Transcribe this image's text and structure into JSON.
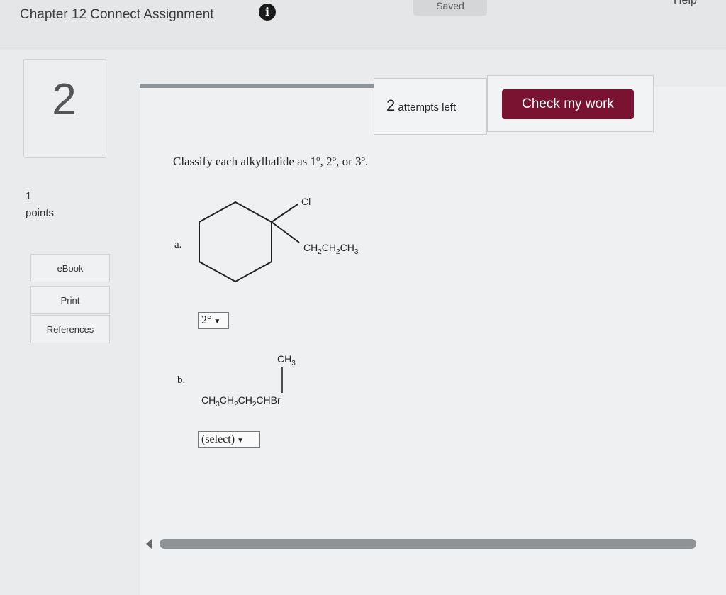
{
  "header": {
    "title": "Chapter 12 Connect Assignment",
    "info_icon": "info-icon",
    "saved": "Saved",
    "help": "Help"
  },
  "question": {
    "number": "2",
    "points_value": "1",
    "points_label": "points",
    "tools": [
      "eBook",
      "Print",
      "References"
    ],
    "attempts_count": "2",
    "attempts_text": "attempts left",
    "check_button": "Check my work",
    "prompt": "Classify each alkylhalide as 1",
    "prompt_parts": [
      "Classify each alkylhalide as 1",
      "o",
      ", 2",
      "o",
      ", or 3",
      "o",
      "."
    ]
  },
  "items": [
    {
      "label": "a.",
      "substituent_top": "Cl",
      "substituent_right": "CH2CH2CH3",
      "selected": "2°"
    },
    {
      "label": "b.",
      "branch_top": "CH3",
      "formula": "CH3CH2CH2CHBr",
      "selected": "(select)"
    }
  ],
  "colors": {
    "check_button": "#7a1232",
    "page_bg": "#e9ebec"
  }
}
